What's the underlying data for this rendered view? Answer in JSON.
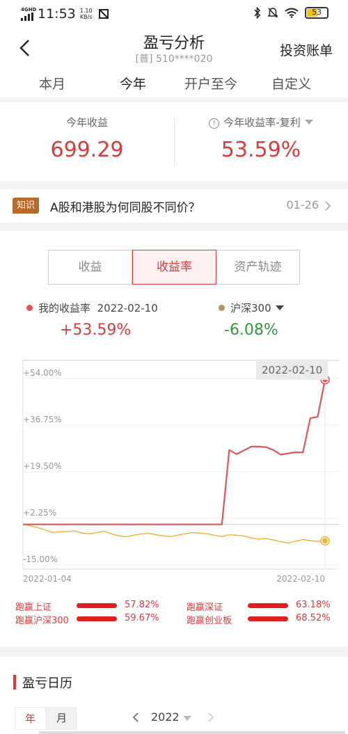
{
  "status_bar": {
    "network": "4GHD",
    "time": "11:53",
    "speed_value": "1.10",
    "speed_unit": "KB/s",
    "battery": "53"
  },
  "header": {
    "title": "盈亏分析",
    "subtitle": "[普] 510****020",
    "right_link": "投资账单"
  },
  "period_tabs": [
    "本月",
    "今年",
    "开户至今",
    "自定义"
  ],
  "active_period_tab": "今年",
  "summary": {
    "profit_label": "今年收益",
    "profit_value": "699.29",
    "rate_label": "今年收益率-复利",
    "rate_value": "53.59%"
  },
  "knowledge": {
    "badge": "知识",
    "title": "A股和港股为何同股不同价？",
    "date": "01-26"
  },
  "chart_tabs": [
    "收益",
    "收益率",
    "资产轨迹"
  ],
  "active_chart_tab": "收益率",
  "legend": {
    "mine_label": "我的收益率",
    "mine_date": "2022-02-10",
    "mine_value": "+53.59%",
    "benchmark_label": "沪深300",
    "benchmark_value": "-6.08%"
  },
  "chart_data": {
    "type": "line",
    "title": "",
    "xlabel": "",
    "ylabel": "",
    "ylim": [
      -15.0,
      54.0
    ],
    "y_ticks": [
      "+54.00%",
      "+36.75%",
      "+19.50%",
      "+2.25%",
      "-15.00%"
    ],
    "x_ticks": [
      "2022-01-04",
      "2022-02-10"
    ],
    "highlight_date": "2022-02-10",
    "series": [
      {
        "name": "我的收益率",
        "color": "#e05555",
        "values": [
          0,
          0,
          0,
          0,
          0,
          0,
          0,
          0,
          0,
          0,
          0,
          0,
          0,
          0,
          0,
          0,
          0,
          0,
          0,
          0,
          0,
          0,
          0,
          0,
          0,
          0,
          0,
          0,
          27.5,
          26.0,
          27.4,
          28.8,
          28.8,
          28.6,
          27.5,
          25.8,
          26.3,
          26.7,
          26.6,
          39.3,
          39.8,
          53.59
        ]
      },
      {
        "name": "沪深300",
        "color": "#e8b339",
        "values": [
          0,
          -0.5,
          -1.2,
          -2.0,
          -3.0,
          -2.8,
          -2.6,
          -2.4,
          -3.2,
          -3.5,
          -3.0,
          -2.5,
          -3.5,
          -4.2,
          -4.6,
          -4.0,
          -3.6,
          -3.3,
          -3.8,
          -4.2,
          -4.5,
          -4.0,
          -3.5,
          -3.0,
          -3.2,
          -3.5,
          -4.0,
          -4.5,
          -3.8,
          -4.0,
          -4.3,
          -5.0,
          -5.5,
          -5.2,
          -5.8,
          -6.4,
          -6.9,
          -6.2,
          -5.6,
          -6.0,
          -6.3,
          -6.08
        ]
      }
    ]
  },
  "stats": [
    {
      "label": "跑赢上证",
      "value": "57.82%"
    },
    {
      "label": "跑赢深证",
      "value": "63.18%"
    },
    {
      "label": "跑赢沪深300",
      "value": "59.67%"
    },
    {
      "label": "跑赢创业板",
      "value": "68.52%"
    }
  ],
  "calendar": {
    "title": "盈亏日历",
    "toggle_year": "年",
    "toggle_month": "月",
    "year": "2022"
  }
}
